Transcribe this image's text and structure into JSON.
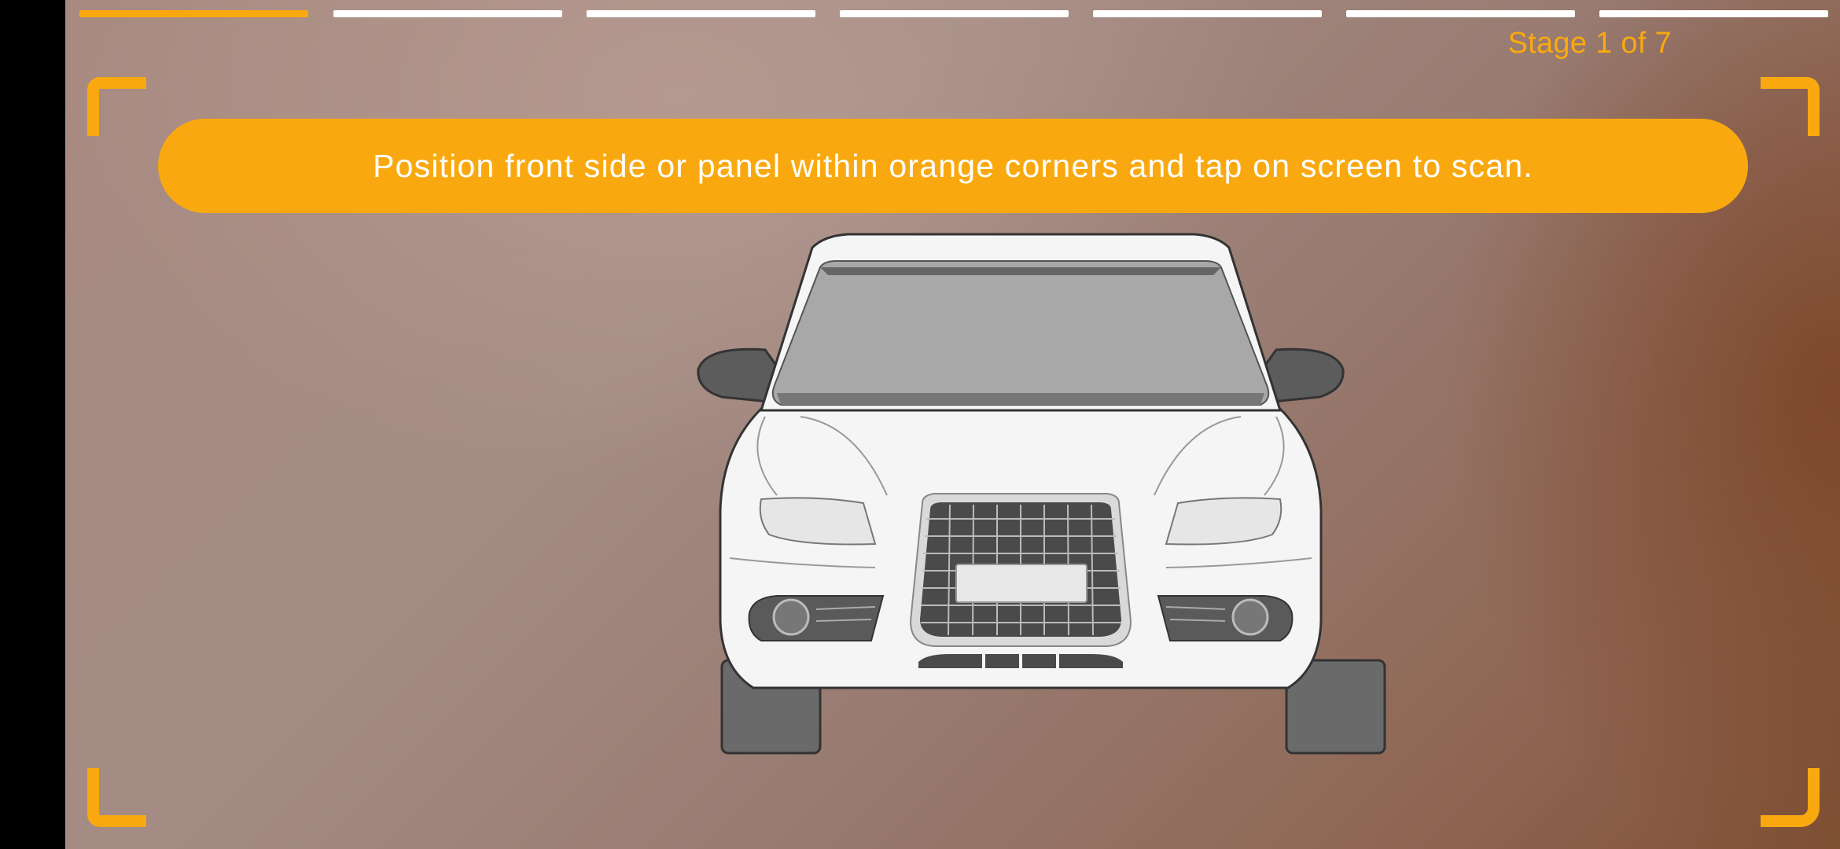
{
  "progress": {
    "total_stages": 7,
    "current_stage": 1,
    "stage_label": "Stage 1 of 7"
  },
  "instruction": {
    "text": "Position front side or panel within orange corners and tap on screen to scan."
  },
  "overlay": {
    "guide_graphic": "car-front-outline-icon",
    "corner_markers": [
      "top-left",
      "top-right",
      "bottom-left",
      "bottom-right"
    ]
  },
  "colors": {
    "accent": "#f9a90f",
    "inactive_segment": "#ffffff",
    "text_on_accent": "#ffffff"
  }
}
